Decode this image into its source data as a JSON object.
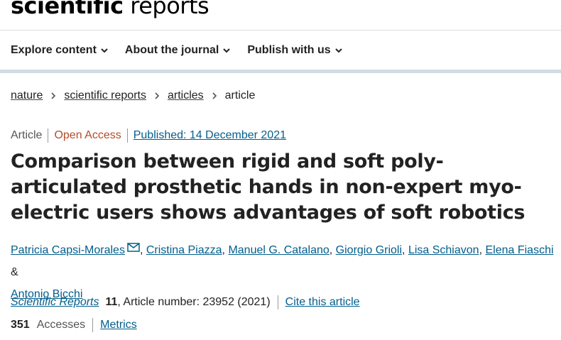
{
  "logo": {
    "bold": "scientific",
    "light": "reports"
  },
  "nav": {
    "items": [
      {
        "label": "Explore content"
      },
      {
        "label": "About the journal"
      },
      {
        "label": "Publish with us"
      }
    ]
  },
  "breadcrumb": {
    "items": [
      "nature",
      "scientific reports",
      "articles"
    ],
    "current": "article"
  },
  "article": {
    "type": "Article",
    "access": "Open Access",
    "published": "Published: 14 December 2021",
    "title": "Comparison between rigid and soft poly-articulated prosthetic hands in non-expert myo-electric users shows advantages of soft robotics",
    "authors": [
      "Patricia Capsi-Morales",
      "Cristina Piazza",
      "Manuel G. Catalano",
      "Giorgio Grioli",
      "Lisa Schiavon",
      "Elena Fiaschi",
      "Antonio Bicchi"
    ],
    "author_sep": ",",
    "author_and": "&",
    "journal": "Scientific Reports",
    "volume": "11",
    "article_number": ", Article number: 23952 (2021)",
    "cite": "Cite this article",
    "accesses_count": "351",
    "accesses_label": "Accesses",
    "metrics": "Metrics"
  },
  "colors": {
    "link": "#025e8d",
    "open_access": "#b24c29",
    "nav_band": "#d0dde3"
  },
  "icons": [
    "chevron-down-icon",
    "chevron-right-icon",
    "mail-icon"
  ]
}
